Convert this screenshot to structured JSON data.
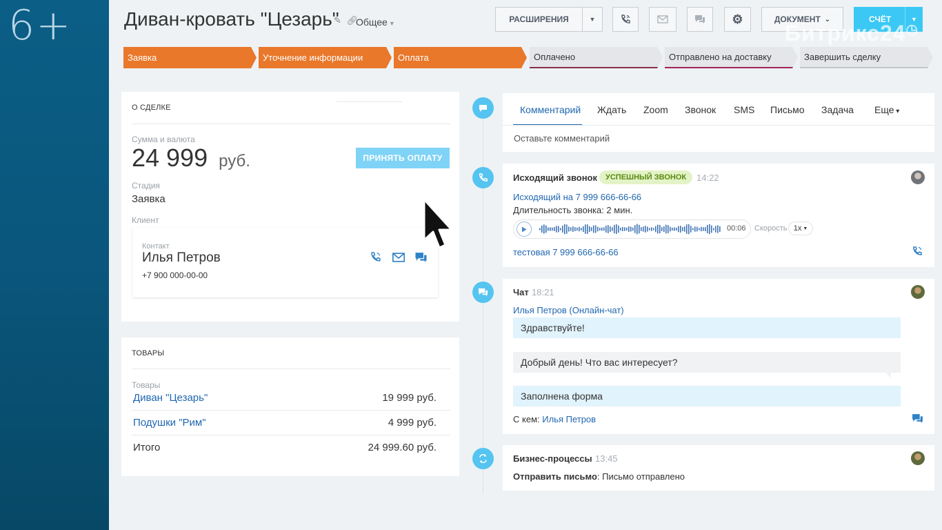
{
  "sidebar": {
    "badge": "6+"
  },
  "header": {
    "title": "Диван-кровать  \"Цезарь\"",
    "category": "Общее",
    "buttons": {
      "extensions": "РАСШИРЕНИЯ",
      "document": "ДОКУМЕНТ",
      "invoice": "СЧЁТ"
    },
    "brand": "Битрикс24"
  },
  "stages": [
    {
      "label": "Заявка",
      "state": "done"
    },
    {
      "label": "Уточнение информации",
      "state": "done"
    },
    {
      "label": "Оплата",
      "state": "done"
    },
    {
      "label": "Оплачено",
      "state": "todo"
    },
    {
      "label": "Отправлено на доставку",
      "state": "todo"
    },
    {
      "label": "Завершить сделку",
      "state": "todo"
    }
  ],
  "deal": {
    "heading": "О СДЕЛКЕ",
    "amount_label": "Сумма и валюта",
    "amount": "24 999",
    "currency": "руб.",
    "pay_button": "ПРИНЯТЬ ОПЛАТУ",
    "stage_label": "Стадия",
    "stage_value": "Заявка",
    "client_label": "Клиент",
    "contact_label": "Контакт",
    "contact_name": "Илья Петров",
    "contact_phone": "+7 900 000-00-00"
  },
  "goods": {
    "heading": "ТОВАРЫ",
    "col_label": "Товары",
    "items": [
      {
        "name": "Диван \"Цезарь\"",
        "price": "19 999 руб."
      },
      {
        "name": "Подушки \"Рим\"",
        "price": "4 999 руб."
      }
    ],
    "total_label": "Итого",
    "total_value": "24 999.60 руб."
  },
  "composer": {
    "tabs": [
      "Комментарий",
      "Ждать",
      "Zoom",
      "Звонок",
      "SMS",
      "Письмо",
      "Задача",
      "Еще"
    ],
    "placeholder": "Оставьте комментарий"
  },
  "call": {
    "title": "Исходящий звонок",
    "badge": "УСПЕШНЫЙ ЗВОНОК",
    "time": "14:22",
    "number_link": "Исходящий на 7 999 666-66-66",
    "duration": "Длительность звонка: 2 мин.",
    "player_time": "00:06",
    "speed_label": "Скорость",
    "speed_value": "1x",
    "footer_link": "тестовая 7 999 666-66-66"
  },
  "chat": {
    "title": "Чат",
    "time": "18:21",
    "source_link": "Илья Петров (Онлайн-чат)",
    "messages": [
      {
        "text": "Здравствуйте!",
        "dir": "in"
      },
      {
        "text": "Добрый день! Что вас интересует?",
        "dir": "out"
      },
      {
        "text": "Заполнена форма",
        "dir": "in"
      }
    ],
    "with_label": "С кем:",
    "with_name": "Илья Петров"
  },
  "bp": {
    "title": "Бизнес-процессы",
    "time": "13:45",
    "action_label": "Отправить письмо",
    "action_result": ": Письмо отправлено"
  },
  "colors": {
    "stage_done": "#e9782b",
    "accent_blue": "#3bc8f5",
    "link": "#2067b0",
    "sidebar": "#0a567c"
  }
}
